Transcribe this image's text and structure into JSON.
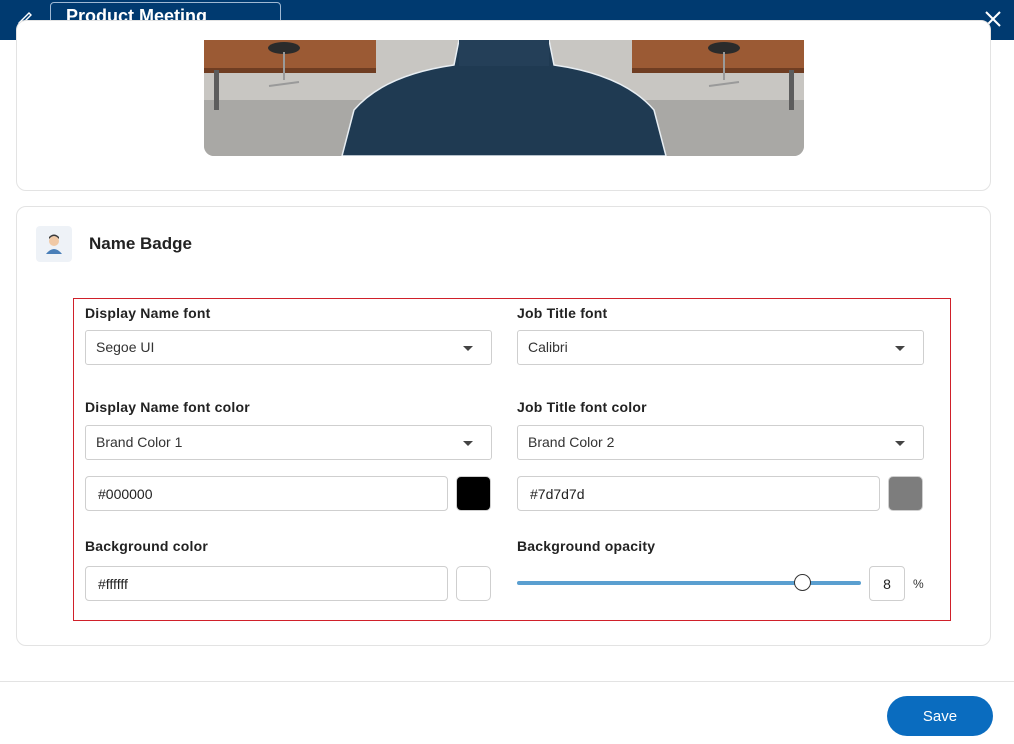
{
  "header": {
    "title": "Product Meeting",
    "edit_icon": "pencil-icon",
    "close_icon": "close-icon",
    "background_color": "#003a70"
  },
  "name_badge": {
    "title": "Name Badge",
    "icon": "person-avatar-icon",
    "display_name_font": {
      "label": "Display Name font",
      "value": "Segoe UI"
    },
    "job_title_font": {
      "label": "Job Title font",
      "value": "Calibri"
    },
    "display_name_font_color": {
      "label": "Display Name font color",
      "value": "Brand Color 1",
      "hex": "#000000",
      "swatch": "#000000"
    },
    "job_title_font_color": {
      "label": "Job Title font color",
      "value": "Brand Color 2",
      "hex": "#7d7d7d",
      "swatch": "#7d7d7d"
    },
    "background_color": {
      "label": "Background color",
      "hex": "#ffffff",
      "swatch": "#ffffff"
    },
    "background_opacity": {
      "label": "Background opacity",
      "value": "8",
      "unit": "%",
      "fraction": 0.8
    }
  },
  "footer": {
    "save_label": "Save",
    "accent": "#0a6cbf"
  }
}
